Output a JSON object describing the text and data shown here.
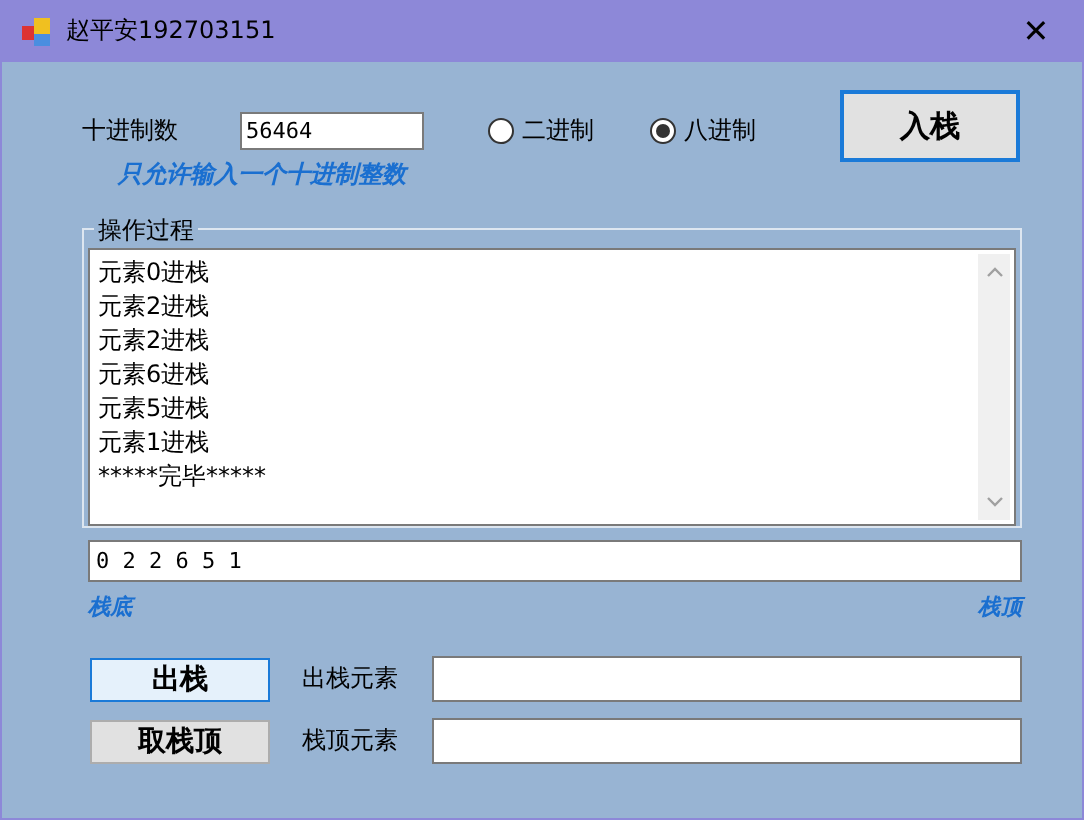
{
  "window": {
    "title": "赵平安192703151",
    "close": "✕"
  },
  "input": {
    "label": "十进制数",
    "value": "56464",
    "hint": "只允许输入一个十进制整数"
  },
  "radios": [
    {
      "label": "二进制",
      "selected": false
    },
    {
      "label": "八进制",
      "selected": true
    }
  ],
  "push_button": "入栈",
  "group": {
    "title": "操作过程",
    "log": [
      "元素0进栈",
      "元素2进栈",
      "元素2进栈",
      "元素6进栈",
      "元素5进栈",
      "元素1进栈",
      "*****完毕*****"
    ]
  },
  "stack_field": "0 2 2 6 5 1",
  "stack_bottom": "栈底",
  "stack_top": "栈顶",
  "actions": [
    {
      "button": "出栈",
      "highlighted": true,
      "label": "出栈元素"
    },
    {
      "button": "取栈顶",
      "highlighted": false,
      "label": "栈顶元素"
    }
  ]
}
